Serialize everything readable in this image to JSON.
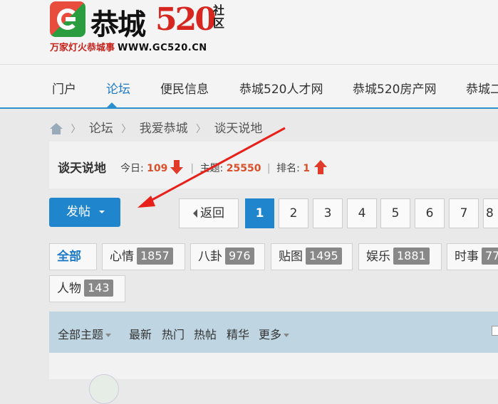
{
  "logo": {
    "title": "恭城",
    "number": "520",
    "community": "社区",
    "slogan": "万家灯火恭城事",
    "url": "WWW.GC520.CN"
  },
  "nav": {
    "items": [
      {
        "label": "门户"
      },
      {
        "label": "论坛"
      },
      {
        "label": "便民信息"
      },
      {
        "label": "恭城520人才网"
      },
      {
        "label": "恭城520房产网"
      },
      {
        "label": "恭城二"
      }
    ],
    "active": "论坛"
  },
  "breadcrumb": {
    "items": [
      "论坛",
      "我爱恭城",
      "谈天说地"
    ],
    "separator": "〉"
  },
  "forum": {
    "name": "谈天说地",
    "today_label": "今日:",
    "today_value": "109",
    "topics_label": "主题:",
    "topics_value": "25550",
    "rank_label": "排名:",
    "rank_value": "1",
    "separator": "|"
  },
  "post_button": {
    "label": "发帖"
  },
  "pager": {
    "back_label": "返回",
    "pages": [
      "1",
      "2",
      "3",
      "4",
      "5",
      "6",
      "7",
      "8"
    ],
    "current": "1"
  },
  "filters": {
    "all_label": "全部",
    "categories": [
      {
        "label": "心情",
        "count": "1857"
      },
      {
        "label": "八卦",
        "count": "976"
      },
      {
        "label": "贴图",
        "count": "1495"
      },
      {
        "label": "娱乐",
        "count": "1881"
      },
      {
        "label": "时事",
        "count": "77"
      },
      {
        "label": "人物",
        "count": "143"
      }
    ]
  },
  "topic_bar": {
    "all_topics": "全部主题",
    "latest": "最新",
    "hot": "热门",
    "hot_posts": "热帖",
    "digest": "精华",
    "more": "更多"
  },
  "colors": {
    "accent": "#1f86cd",
    "annotation_arrow": "#e8201a",
    "topic_bar": "#bfd6e2",
    "stat_number": "#d9502b"
  },
  "icons": {
    "home": "home-icon",
    "today_trend": "arrow-down-icon",
    "rank_trend": "arrow-up-icon"
  }
}
